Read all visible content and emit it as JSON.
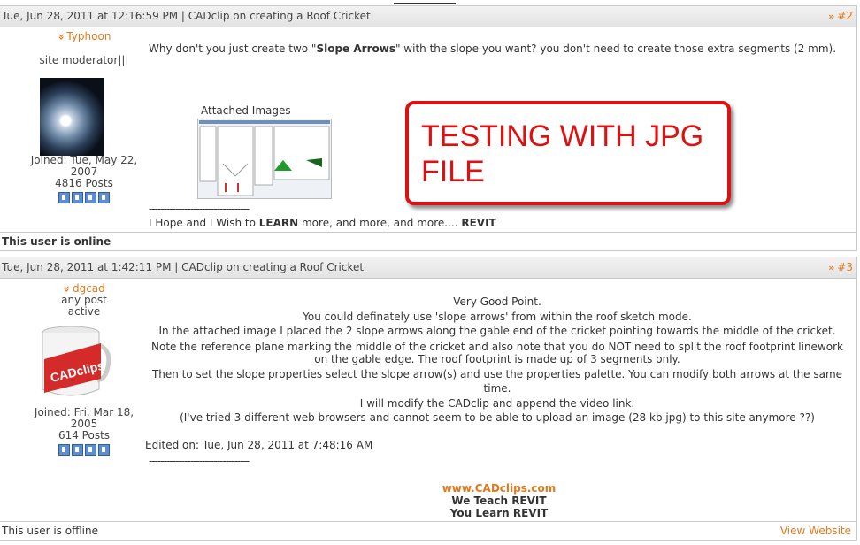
{
  "top_link": "",
  "posts": [
    {
      "header": "Tue, Jun 28, 2011 at 12:16:59 PM | CADclip on creating a Roof Cricket",
      "number": "#2",
      "username": "Typhoon",
      "role": "site moderator|||",
      "joined": "Joined: Tue, May 22, 2007",
      "posts": "4816 Posts",
      "body_prefix": "Why don't you just create two \"",
      "body_bold": "Slope Arrows",
      "body_suffix": "\" with the slope you want? you don't need to create those extra segments (2 mm).",
      "attached_label": "Attached Images",
      "separator": "----------------------------------",
      "signature_prefix": "I Hope and I Wish to ",
      "signature_bold1": "LEARN",
      "signature_middle": " more, and more, and more.... ",
      "signature_bold2": "REVIT",
      "footer": "This user is online"
    },
    {
      "header": "Tue, Jun 28, 2011 at 1:42:11 PM | CADclip on creating a Roof Cricket",
      "number": "#3",
      "username": "dgcad",
      "role_line1": "any post",
      "role_line2": "active",
      "joined": "Joined: Fri, Mar 18, 2005",
      "posts": "614 Posts",
      "lines": [
        "Very Good Point.",
        "You could definately use 'slope arrows' from within the roof sketch mode.",
        "In the attached image I placed the 2 slope arrows along the gable end of the cricket pointing towards the middle of the cricket.",
        "Note the reference plane marking the middle of the cricket and also note that you do NOT need to split the roof footprint linework on the gable edge. The roof footprint is made up of 3 segments only.",
        "Then to set the slope properties select the slope arrow(s) and use the properties palette. You can modify both arrows at the same time.",
        "I will modify the CADclip and append the video link.",
        "(I've tried 3 different web browsers and cannot seem to be able to upload an image (28 kb jpg) to this site anymore ??)"
      ],
      "edited": "Edited on: Tue, Jun 28, 2011 at 7:48:16 AM",
      "separator": "----------------------------------",
      "sig_link": "www.CADclips.com",
      "sig_line1": "We Teach REVIT",
      "sig_line2": "You Learn REVIT",
      "footer": "This user is offline",
      "view_website": "View Website"
    }
  ],
  "callout": {
    "line1": "TESTING WITH JPG",
    "line2": "FILE"
  },
  "avatar2_text": "CADclips",
  "colors": {
    "accent": "#e07a1f",
    "callout_red": "#dd1111"
  }
}
